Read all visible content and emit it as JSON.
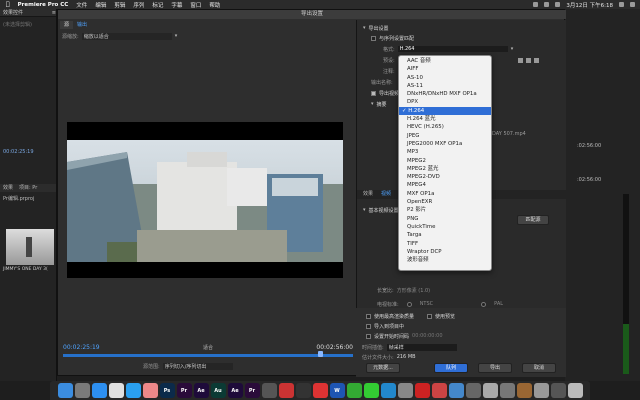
{
  "menubar": {
    "app": "Premiere Pro CC",
    "items": [
      "文件",
      "编辑",
      "剪辑",
      "序列",
      "标记",
      "字幕",
      "窗口",
      "帮助"
    ],
    "date": "3月12日 下午6:18"
  },
  "left": {
    "tab1": "效果控件",
    "tab1b": "≡",
    "tab2": "音频",
    "no_clip": "(未选择剪辑)",
    "tc1": "00:02:25:19",
    "proj_tab": "效果",
    "proj_tab2": "项目: Pr",
    "proj_file": "Pr编辑.prproj",
    "thumb_label": "JIMMY'S ONE DAY 3("
  },
  "dialog": {
    "title": "导出设置",
    "tabs": [
      "源",
      "输出"
    ],
    "source_scale_label": "源缩放:",
    "source_scale_value": "缩放以适合",
    "tc_left": "00:02:25:19",
    "fit": "适合",
    "tc_right": "00:02:56:00",
    "source_range_label": "源范围:",
    "source_range_value": "序列切入/序列切出",
    "export_settings": "导出设置",
    "match_seq": "与序列设置匹配",
    "format_label": "格式:",
    "format_value": "H.264",
    "preset_label": "预设:",
    "comment_label": "注释:",
    "output_label": "输出名称:",
    "export_video": "导出视频",
    "summary": "摘要",
    "output_path": "DAY 507.mp4",
    "tabs2": [
      "效果",
      "视频"
    ],
    "basic_video": "基本视频设置",
    "match_source": "匹配源",
    "aspect_label": "长宽比:",
    "aspect_value": "方形像素 (1.0)",
    "tv_label": "电视标准:",
    "tv_ntsc": "NTSC",
    "tv_pal": "PAL",
    "max_quality": "使用最高渲染质量",
    "use_preview": "使用预览",
    "import_project": "导入到项目中",
    "set_start_tc": "设置开始时间码",
    "start_tc_val": "00:00:00:00",
    "interp_label": "时间插值:",
    "interp_value": "帧采样",
    "filesize_label": "估计文件大小:",
    "filesize_value": "216 MB",
    "meta_btn": "元数据...",
    "queue_btn": "队列",
    "export_btn": "导出",
    "cancel_btn": "取消"
  },
  "format_options": [
    "AAC 音频",
    "AIFF",
    "AS-10",
    "AS-11",
    "DNxHR/DNxHD MXF OP1a",
    "DPX",
    "H.264",
    "H.264 蓝光",
    "HEVC (H.265)",
    "JPEG",
    "JPEG2000 MXF OP1a",
    "MP3",
    "MPEG2",
    "MPEG2 蓝光",
    "MPEG2-DVD",
    "MPEG4",
    "MXF OP1a",
    "OpenEXR",
    "P2 影片",
    "PNG",
    "QuickTime",
    "Targa",
    "TIFF",
    "Wraptor DCP",
    "波形音频"
  ],
  "selected_format": "H.264",
  "right": {
    "tc": ":02:56:00",
    "tc2": ":02:56:00"
  },
  "dock": [
    {
      "name": "finder",
      "label": "",
      "color": "#3b8de0"
    },
    {
      "name": "launchpad",
      "label": "",
      "color": "#7a7a7a"
    },
    {
      "name": "safari",
      "label": "",
      "color": "#2d8ff0"
    },
    {
      "name": "chrome",
      "label": "",
      "color": "#e0e0e0"
    },
    {
      "name": "qq",
      "label": "",
      "color": "#2aa0f0"
    },
    {
      "name": "photos",
      "label": "",
      "color": "#e88"
    },
    {
      "name": "photoshop",
      "label": "Ps",
      "color": "#0b2a4a"
    },
    {
      "name": "premiere",
      "label": "Pr",
      "color": "#2a0b3a"
    },
    {
      "name": "after-effects",
      "label": "Ae",
      "color": "#1e0b3a"
    },
    {
      "name": "audition",
      "label": "Au",
      "color": "#0b3a34"
    },
    {
      "name": "after-effects-2",
      "label": "Ae",
      "color": "#1e0b3a"
    },
    {
      "name": "premiere-2",
      "label": "Pr",
      "color": "#2a0b3a"
    },
    {
      "name": "davinci",
      "label": "",
      "color": "#555"
    },
    {
      "name": "app-1",
      "label": "",
      "color": "#c33"
    },
    {
      "name": "app-2",
      "label": "",
      "color": "#333"
    },
    {
      "name": "app-3",
      "label": "",
      "color": "#d33"
    },
    {
      "name": "word",
      "label": "W",
      "color": "#1e55b3"
    },
    {
      "name": "app-4",
      "label": "",
      "color": "#3a3"
    },
    {
      "name": "wechat",
      "label": "",
      "color": "#3c3"
    },
    {
      "name": "app-5",
      "label": "",
      "color": "#28c"
    },
    {
      "name": "app-6",
      "label": "",
      "color": "#888"
    },
    {
      "name": "app-7",
      "label": "",
      "color": "#c22"
    },
    {
      "name": "app-8",
      "label": "",
      "color": "#c44"
    },
    {
      "name": "app-9",
      "label": "",
      "color": "#48c"
    },
    {
      "name": "app-10",
      "label": "",
      "color": "#666"
    },
    {
      "name": "app-11",
      "label": "",
      "color": "#aaa"
    },
    {
      "name": "app-12",
      "label": "",
      "color": "#777"
    },
    {
      "name": "app-13",
      "label": "",
      "color": "#963"
    },
    {
      "name": "app-14",
      "label": "",
      "color": "#999"
    },
    {
      "name": "app-15",
      "label": "",
      "color": "#555"
    },
    {
      "name": "trash",
      "label": "",
      "color": "#bbb"
    }
  ]
}
